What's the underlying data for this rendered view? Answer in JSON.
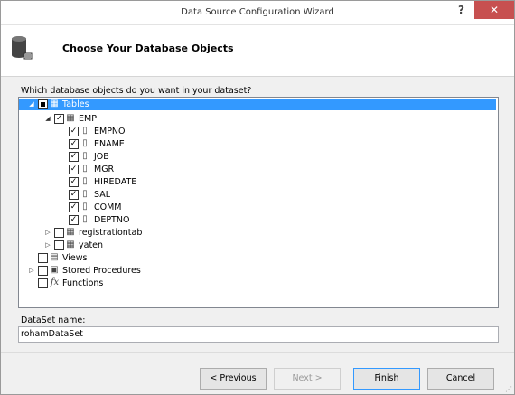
{
  "window": {
    "title": "Data Source Configuration Wizard",
    "help_glyph": "?",
    "close_glyph": "✕"
  },
  "header": {
    "title": "Choose Your Database Objects",
    "icon": "database-icon"
  },
  "prompt": "Which database objects do you want in your dataset?",
  "tree": {
    "tables": {
      "label": "Tables",
      "state": "indeterminate",
      "expanded": true,
      "selected": true
    },
    "emp": {
      "label": "EMP",
      "state": "checked",
      "expanded": true
    },
    "columns": [
      {
        "label": "EMPNO",
        "state": "checked"
      },
      {
        "label": "ENAME",
        "state": "checked"
      },
      {
        "label": "JOB",
        "state": "checked"
      },
      {
        "label": "MGR",
        "state": "checked"
      },
      {
        "label": "HIREDATE",
        "state": "checked"
      },
      {
        "label": "SAL",
        "state": "checked"
      },
      {
        "label": "COMM",
        "state": "checked"
      },
      {
        "label": "DEPTNO",
        "state": "checked"
      }
    ],
    "other_tables": [
      {
        "label": "registrationtab",
        "state": "unchecked"
      },
      {
        "label": "yaten",
        "state": "unchecked"
      }
    ],
    "views": {
      "label": "Views",
      "state": "unchecked"
    },
    "procedures": {
      "label": "Stored Procedures",
      "state": "unchecked"
    },
    "functions": {
      "label": "Functions",
      "state": "unchecked"
    }
  },
  "dataset": {
    "label": "DataSet name:",
    "value": "rohamDataSet"
  },
  "buttons": {
    "previous": "< Previous",
    "next": "Next >",
    "finish": "Finish",
    "cancel": "Cancel"
  },
  "colors": {
    "selection": "#3399ff",
    "close": "#c75050"
  }
}
